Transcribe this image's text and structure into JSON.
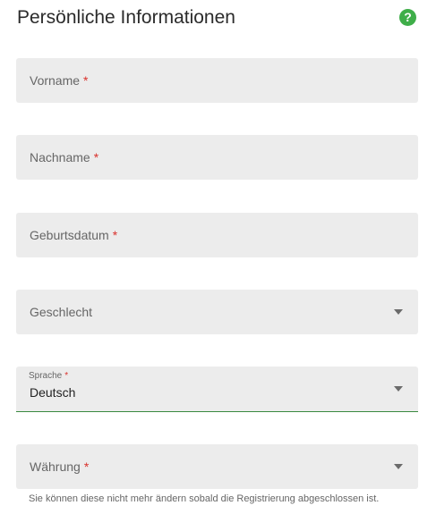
{
  "section": {
    "title": "Persönliche Informationen",
    "help_icon": "question-circle-icon",
    "help_glyph": "?",
    "required_marker": "*"
  },
  "fields": {
    "first_name": {
      "label": "Vorname",
      "required": true
    },
    "last_name": {
      "label": "Nachname",
      "required": true
    },
    "birthdate": {
      "label": "Geburtsdatum",
      "required": true
    },
    "gender": {
      "label": "Geschlecht",
      "required": false,
      "type": "select"
    },
    "language": {
      "label": "Sprache",
      "required": true,
      "type": "select",
      "value": "Deutsch"
    },
    "currency": {
      "label": "Währung",
      "required": true,
      "type": "select",
      "hint": "Sie können diese nicht mehr ändern sobald die Registrierung abgeschlossen ist."
    }
  },
  "colors": {
    "accent_green": "#3fae49",
    "required_red": "#d9312c",
    "field_bg": "#ececec",
    "active_underline": "#3a8a3f"
  }
}
